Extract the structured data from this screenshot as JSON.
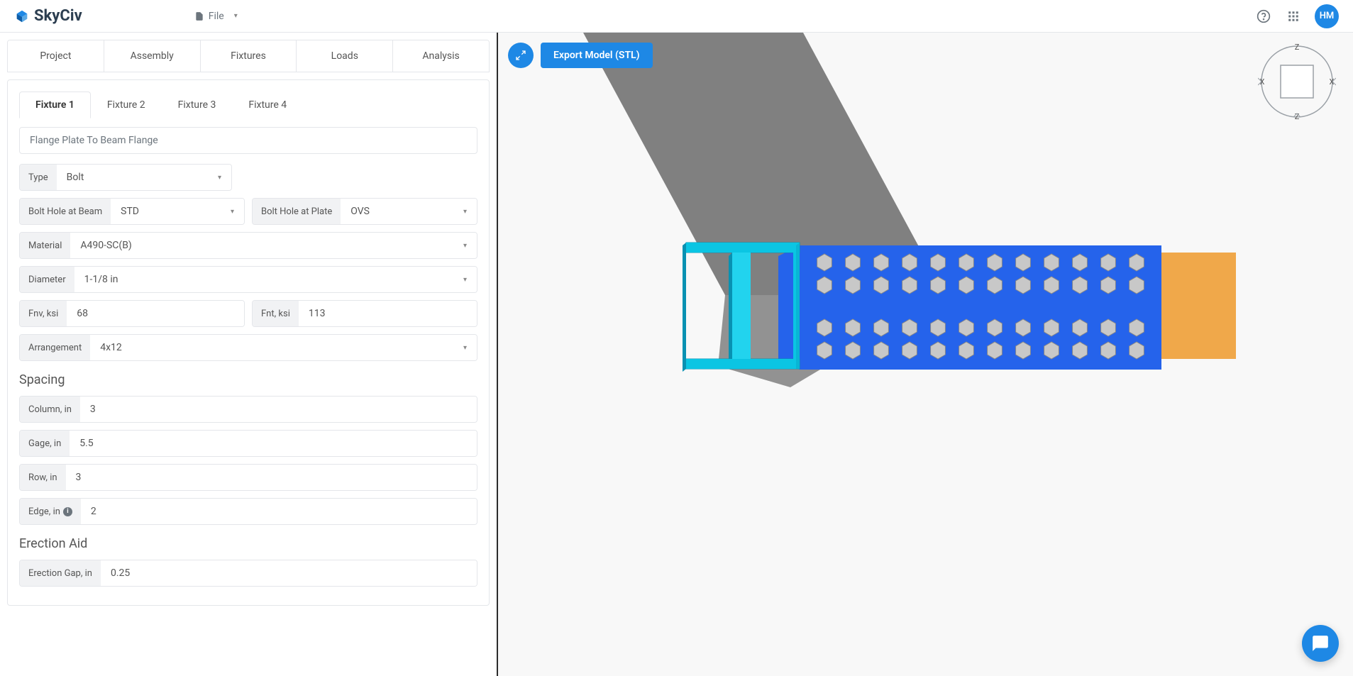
{
  "brand": "SkyCiv",
  "file_menu_label": "File",
  "avatar_initials": "HM",
  "export_button": "Export Model (STL)",
  "main_tabs": [
    "Project",
    "Assembly",
    "Fixtures",
    "Loads",
    "Analysis"
  ],
  "main_tab_active_index": 2,
  "fixture_tabs": [
    "Fixture 1",
    "Fixture 2",
    "Fixture 3",
    "Fixture 4"
  ],
  "fixture_tab_active_index": 0,
  "description": "Flange Plate To Beam Flange",
  "labels": {
    "type": "Type",
    "bolt_hole_beam": "Bolt Hole at Beam",
    "bolt_hole_plate": "Bolt Hole at Plate",
    "material": "Material",
    "diameter": "Diameter",
    "fnv": "Fnv, ksi",
    "fnt": "Fnt, ksi",
    "arrangement": "Arrangement",
    "spacing": "Spacing",
    "column": "Column, in",
    "gage": "Gage, in",
    "row": "Row, in",
    "edge": "Edge, in",
    "erection_aid": "Erection Aid",
    "erection_gap": "Erection Gap, in"
  },
  "values": {
    "type": "Bolt",
    "bolt_hole_beam": "STD",
    "bolt_hole_plate": "OVS",
    "material": "A490-SC(B)",
    "diameter": "1-1/8 in",
    "fnv": "68",
    "fnt": "113",
    "arrangement": "4x12",
    "column": "3",
    "gage": "5.5",
    "row": "3",
    "edge": "2",
    "erection_gap": "0.25"
  },
  "navcube": {
    "top": "Z",
    "bottom": "Z",
    "left": "X",
    "right": "X"
  }
}
